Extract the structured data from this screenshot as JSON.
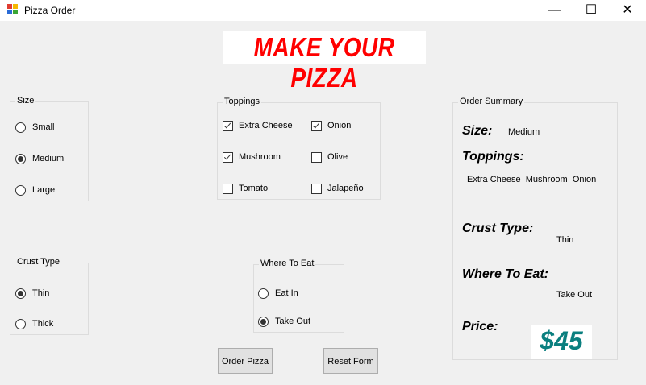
{
  "window": {
    "title": "Pizza Order",
    "minimize": "—",
    "maximize": "☐",
    "close": "✕"
  },
  "banner": {
    "text": "MAKE YOUR PIZZA",
    "color": "#ff0000"
  },
  "size_group": {
    "title": "Size",
    "options": [
      {
        "label": "Small",
        "selected": false
      },
      {
        "label": "Medium",
        "selected": true
      },
      {
        "label": "Large",
        "selected": false
      }
    ]
  },
  "toppings_group": {
    "title": "Toppings",
    "options": [
      {
        "label": "Extra Cheese",
        "checked": true
      },
      {
        "label": "Onion",
        "checked": true
      },
      {
        "label": "Mushroom",
        "checked": true
      },
      {
        "label": "Olive",
        "checked": false
      },
      {
        "label": "Tomato",
        "checked": false
      },
      {
        "label": "Jalapeño",
        "checked": false
      }
    ]
  },
  "crust_group": {
    "title": "Crust Type",
    "options": [
      {
        "label": "Thin",
        "selected": true
      },
      {
        "label": "Thick",
        "selected": false
      }
    ]
  },
  "where_group": {
    "title": "Where To Eat",
    "options": [
      {
        "label": "Eat In",
        "selected": false
      },
      {
        "label": "Take Out",
        "selected": true
      }
    ]
  },
  "buttons": {
    "order": "Order Pizza",
    "reset": "Reset Form"
  },
  "summary": {
    "title": "Order Summary",
    "size_label": "Size:",
    "size_value": "Medium",
    "toppings_label": "Toppings:",
    "toppings_value": "Extra Cheese  Mushroom  Onion",
    "crust_label": "Crust Type:",
    "crust_value": "Thin",
    "where_label": "Where To Eat:",
    "where_value": "Take Out",
    "price_label": "Price:",
    "price_value": "$45",
    "price_color": "#0a7f7f"
  }
}
